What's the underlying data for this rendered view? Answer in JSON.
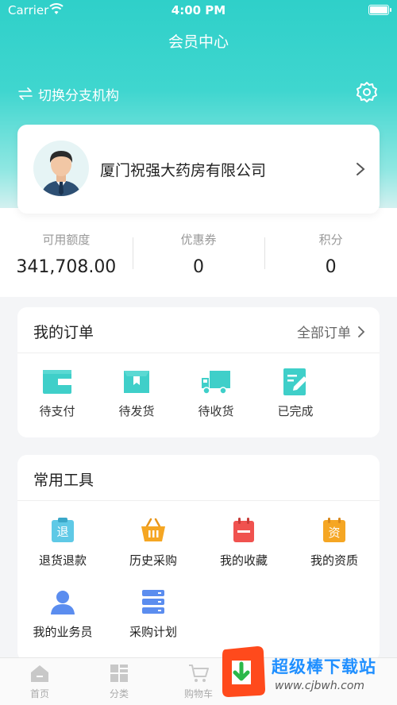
{
  "status_bar": {
    "carrier": "Carrier",
    "time": "4:00 PM"
  },
  "header": {
    "title": "会员中心"
  },
  "branch": {
    "switch_label": "切换分支机构"
  },
  "company": {
    "name": "厦门祝强大药房有限公司"
  },
  "stats": [
    {
      "label": "可用额度",
      "value": "341,708.00"
    },
    {
      "label": "优惠券",
      "value": "0"
    },
    {
      "label": "积分",
      "value": "0"
    }
  ],
  "orders": {
    "title": "我的订单",
    "all_label": "全部订单",
    "items": [
      {
        "label": "待支付",
        "icon": "wallet-icon"
      },
      {
        "label": "待发货",
        "icon": "box-icon"
      },
      {
        "label": "待收货",
        "icon": "truck-icon"
      },
      {
        "label": "已完成",
        "icon": "document-check-icon"
      }
    ]
  },
  "tools": {
    "title": "常用工具",
    "items": [
      {
        "label": "退货退款",
        "icon": "return-icon",
        "icon_text": "退"
      },
      {
        "label": "历史采购",
        "icon": "basket-icon"
      },
      {
        "label": "我的收藏",
        "icon": "favorites-icon"
      },
      {
        "label": "我的资质",
        "icon": "qualification-icon",
        "icon_text": "资"
      },
      {
        "label": "我的业务员",
        "icon": "salesman-icon"
      },
      {
        "label": "采购计划",
        "icon": "plan-icon"
      }
    ]
  },
  "tab_bar": {
    "items": [
      {
        "label": "首页",
        "icon": "home-icon"
      },
      {
        "label": "分类",
        "icon": "category-icon"
      },
      {
        "label": "购物车",
        "icon": "cart-icon"
      }
    ]
  },
  "watermark": {
    "title": "超级棒下载站",
    "url": "www.cjbwh.com"
  },
  "colors": {
    "primary": "#2fd0c9",
    "orange": "#f5a623",
    "red": "#f0524f",
    "blue": "#5b8def"
  }
}
